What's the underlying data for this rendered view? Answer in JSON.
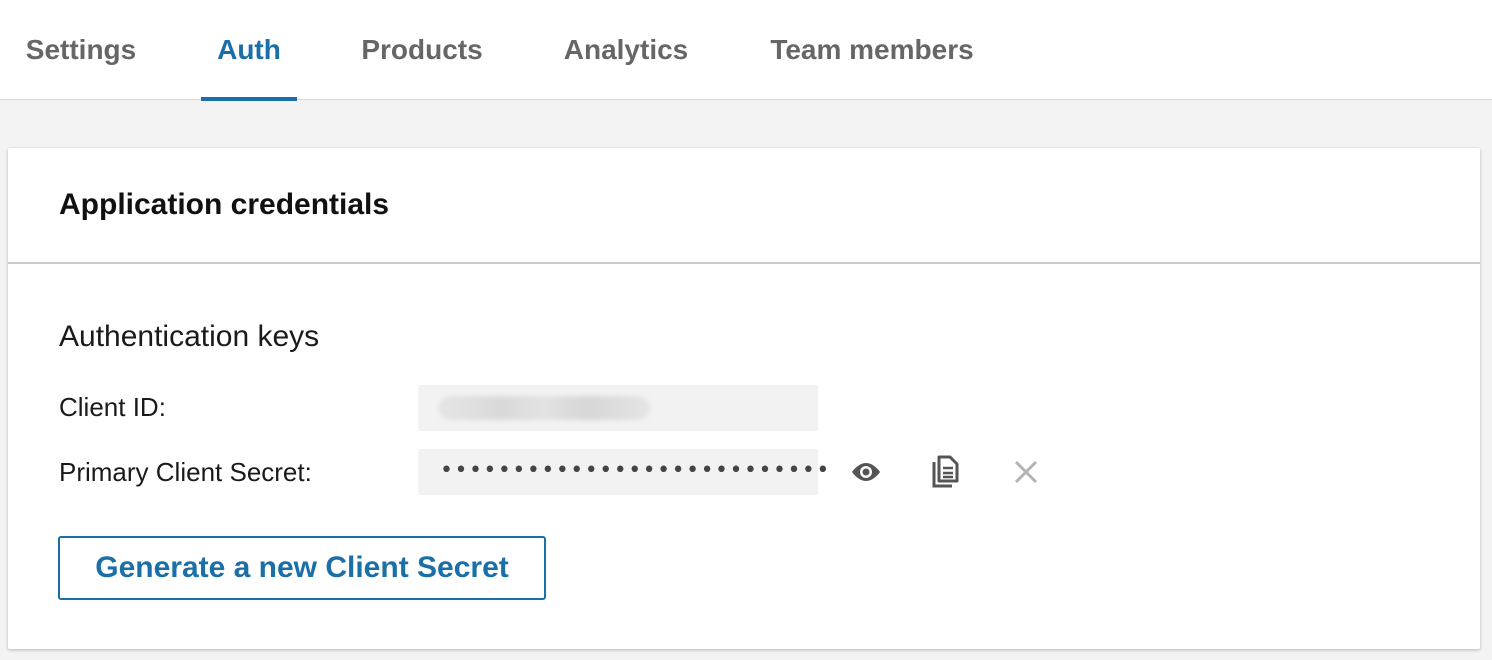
{
  "tabs": [
    {
      "label": "Settings"
    },
    {
      "label": "Auth",
      "active": true
    },
    {
      "label": "Products"
    },
    {
      "label": "Analytics"
    },
    {
      "label": "Team members"
    }
  ],
  "card": {
    "title": "Application credentials",
    "section_title": "Authentication keys",
    "client_id": {
      "label": "Client ID:",
      "value_state": "blurred"
    },
    "client_secret": {
      "label": "Primary Client Secret:",
      "masked_value": "•••••••••••••••••••••••••••",
      "icons": [
        "eye-icon",
        "copy-icon",
        "close-icon"
      ]
    },
    "generate_button_label": "Generate a new Client Secret"
  },
  "colors": {
    "accent": "#1b6fa8",
    "tab_inactive": "#666666",
    "field_bg": "#f2f2f2",
    "page_bg": "#f3f3f3"
  }
}
